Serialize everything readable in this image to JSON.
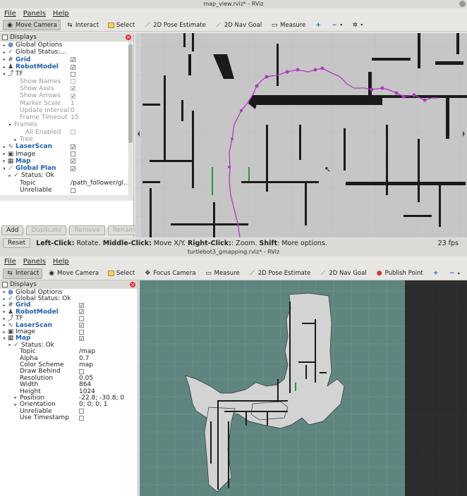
{
  "window1": {
    "title": "map_view.rviz* - RViz",
    "menu": [
      "File",
      "Panels",
      "Help"
    ],
    "toolbar": [
      "Move Camera",
      "Interact",
      "Select",
      "2D Pose Estimate",
      "2D Nav Goal",
      "Measure"
    ],
    "displays_title": "Displays",
    "rows": [
      {
        "indent": 0,
        "arrow": "▸",
        "icon": "●",
        "name": "Global Options",
        "style": ""
      },
      {
        "indent": 0,
        "arrow": "▸",
        "icon": "✓",
        "name": "Global Status:...",
        "style": ""
      },
      {
        "indent": 0,
        "arrow": "▸",
        "icon": "#",
        "name": "Grid",
        "style": "blue",
        "cb": "✓"
      },
      {
        "indent": 0,
        "arrow": "▸",
        "icon": "♟",
        "name": "RobotModel",
        "style": "blue",
        "cb": "✓"
      },
      {
        "indent": 0,
        "arrow": "▾",
        "icon": "⤴",
        "name": "TF",
        "style": "",
        "cb": ""
      },
      {
        "indent": 2,
        "arrow": "",
        "icon": "",
        "name": "Show Names",
        "style": "dim",
        "cb": ""
      },
      {
        "indent": 2,
        "arrow": "",
        "icon": "",
        "name": "Show Axes",
        "style": "dim",
        "cb": "✓"
      },
      {
        "indent": 2,
        "arrow": "",
        "icon": "",
        "name": "Show Arrows",
        "style": "dim",
        "cb": "✓"
      },
      {
        "indent": 2,
        "arrow": "",
        "icon": "",
        "name": "Marker Scale",
        "style": "dim",
        "val": "1"
      },
      {
        "indent": 2,
        "arrow": "",
        "icon": "",
        "name": "Update Interval",
        "style": "dim",
        "val": "0"
      },
      {
        "indent": 2,
        "arrow": "",
        "icon": "",
        "name": "Frame Timeout",
        "style": "dim",
        "val": "15"
      },
      {
        "indent": 1,
        "arrow": "▾",
        "icon": "",
        "name": "Frames",
        "style": "dim"
      },
      {
        "indent": 3,
        "arrow": "",
        "icon": "",
        "name": "All Enabled",
        "style": "dim",
        "cb": ""
      },
      {
        "indent": 2,
        "arrow": "▸",
        "icon": "",
        "name": "Tree",
        "style": "dim"
      },
      {
        "indent": 0,
        "arrow": "▸",
        "icon": "∿",
        "name": "LaserScan",
        "style": "blue",
        "cb": "✓"
      },
      {
        "indent": 0,
        "arrow": "▸",
        "icon": "▣",
        "name": "Image",
        "style": "",
        "cb": ""
      },
      {
        "indent": 0,
        "arrow": "▸",
        "icon": "▦",
        "name": "Map",
        "style": "blue",
        "cb": "✓"
      },
      {
        "indent": 0,
        "arrow": "▾",
        "icon": "⟋",
        "name": "Global Plan",
        "style": "blue",
        "cb": "✓"
      },
      {
        "indent": 1,
        "arrow": "▸",
        "icon": "✓",
        "name": "Status: Ok",
        "style": ""
      },
      {
        "indent": 2,
        "arrow": "",
        "icon": "",
        "name": "Topic",
        "style": "",
        "val": "/path_follower/gl..."
      },
      {
        "indent": 2,
        "arrow": "",
        "icon": "",
        "name": "Unreliable",
        "style": "",
        "cb": ""
      }
    ],
    "buttons": [
      "Add",
      "Duplicate",
      "Remove",
      "Rename"
    ],
    "reset": "Reset",
    "hint_left": "Left-Click:",
    "hint_left_t": " Rotate. ",
    "hint_mid": "Middle-Click:",
    "hint_mid_t": " Move X/Y. ",
    "hint_right": "Right-Click:",
    "hint_right_t": ": Zoom. ",
    "hint_shift": "Shift",
    "hint_shift_t": ": More options.",
    "fps": "23 fps"
  },
  "window2": {
    "title": "turtlebot3_gmapping.rviz* - RViz",
    "menu": [
      "File",
      "Panels",
      "Help"
    ],
    "toolbar": [
      "Interact",
      "Move Camera",
      "Select",
      "Focus Camera",
      "Measure",
      "2D Pose Estimate",
      "2D Nav Goal",
      "Publish Point"
    ],
    "displays_title": "Displays",
    "rows": [
      {
        "indent": 0,
        "arrow": "▸",
        "icon": "●",
        "name": "Global Options",
        "style": ""
      },
      {
        "indent": 0,
        "arrow": "▸",
        "icon": "✓",
        "name": "Global Status: Ok",
        "style": ""
      },
      {
        "indent": 0,
        "arrow": "▸",
        "icon": "#",
        "name": "Grid",
        "style": "blue",
        "cb": "✓"
      },
      {
        "indent": 0,
        "arrow": "▸",
        "icon": "♟",
        "name": "RobotModel",
        "style": "blue",
        "cb": "✓"
      },
      {
        "indent": 0,
        "arrow": "▸",
        "icon": "⤴",
        "name": "TF",
        "style": "",
        "cb": ""
      },
      {
        "indent": 0,
        "arrow": "▸",
        "icon": "∿",
        "name": "LaserScan",
        "style": "blue",
        "cb": "✓"
      },
      {
        "indent": 0,
        "arrow": "▸",
        "icon": "▣",
        "name": "Image",
        "style": "",
        "cb": ""
      },
      {
        "indent": 0,
        "arrow": "▾",
        "icon": "▦",
        "name": "Map",
        "style": "blue",
        "cb": "✓"
      },
      {
        "indent": 1,
        "arrow": "▸",
        "icon": "✓",
        "name": "Status: Ok",
        "style": ""
      },
      {
        "indent": 2,
        "arrow": "",
        "icon": "",
        "name": "Topic",
        "style": "",
        "val": "/map"
      },
      {
        "indent": 2,
        "arrow": "",
        "icon": "",
        "name": "Alpha",
        "style": "",
        "val": "0.7"
      },
      {
        "indent": 2,
        "arrow": "",
        "icon": "",
        "name": "Color Scheme",
        "style": "",
        "val": "map"
      },
      {
        "indent": 2,
        "arrow": "",
        "icon": "",
        "name": "Draw Behind",
        "style": "",
        "cb": ""
      },
      {
        "indent": 2,
        "arrow": "",
        "icon": "",
        "name": "Resolution",
        "style": "",
        "val": "0.05"
      },
      {
        "indent": 2,
        "arrow": "",
        "icon": "",
        "name": "Width",
        "style": "",
        "val": "864"
      },
      {
        "indent": 2,
        "arrow": "",
        "icon": "",
        "name": "Height",
        "style": "",
        "val": "1024"
      },
      {
        "indent": 2,
        "arrow": "▸",
        "icon": "",
        "name": "Position",
        "style": "",
        "val": "-22.8; -30.8; 0"
      },
      {
        "indent": 2,
        "arrow": "▸",
        "icon": "",
        "name": "Orientation",
        "style": "",
        "val": "0; 0; 0; 1"
      },
      {
        "indent": 2,
        "arrow": "",
        "icon": "",
        "name": "Unreliable",
        "style": "",
        "cb": ""
      },
      {
        "indent": 2,
        "arrow": "",
        "icon": "",
        "name": "Use Timestamp",
        "style": "",
        "cb": ""
      }
    ]
  },
  "colors": {
    "map_bg": "#c9c9c9",
    "wall": "#1a1a1a",
    "path": "#b03ac0",
    "grid_teal": "#5f8580",
    "occupied_light": "#d5d5d5"
  }
}
